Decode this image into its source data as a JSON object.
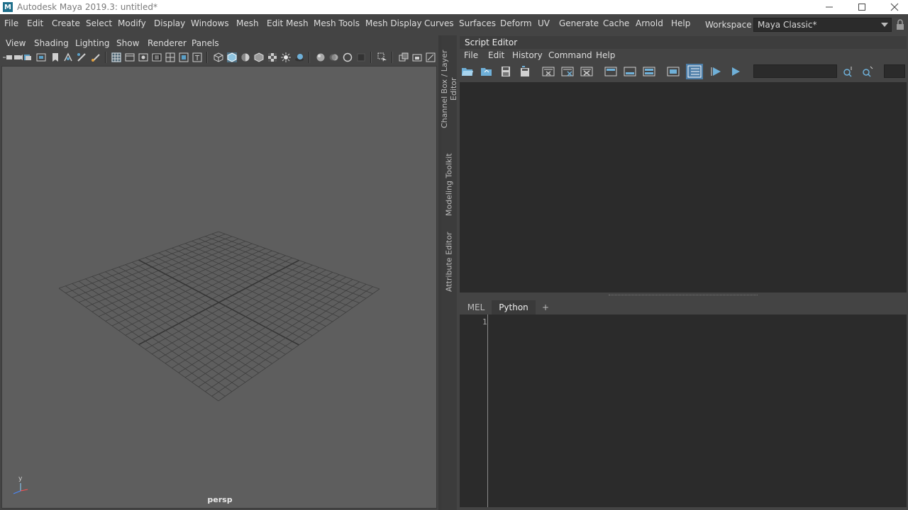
{
  "titlebar": {
    "app_icon": "maya-logo-icon",
    "title": "Autodesk Maya 2019.3: untitled*"
  },
  "menubar": {
    "items": [
      "File",
      "Edit",
      "Create",
      "Select",
      "Modify",
      "Display",
      "Windows",
      "Mesh",
      "Edit Mesh",
      "Mesh Tools",
      "Mesh Display",
      "Curves",
      "Surfaces",
      "Deform",
      "UV",
      "Generate",
      "Cache",
      "Arnold",
      "Help"
    ]
  },
  "workspace": {
    "label": "Workspace :",
    "value": "Maya Classic*"
  },
  "viewport": {
    "menu": [
      "View",
      "Shading",
      "Lighting",
      "Show",
      "Renderer",
      "Panels"
    ],
    "camera": "persp",
    "axis_label": "y",
    "grid_color": "#3f3f3f",
    "background": "#5e5e5e"
  },
  "side_tabs": [
    "Channel Box / Layer Editor",
    "Modeling Toolkit",
    "Attribute Editor"
  ],
  "script_editor": {
    "title": "Script Editor",
    "menu": [
      "File",
      "Edit",
      "History",
      "Command",
      "Help"
    ],
    "tabs": [
      {
        "label": "MEL",
        "active": false
      },
      {
        "label": "Python",
        "active": true
      },
      {
        "label": "+",
        "active": false
      }
    ],
    "line_number": "1"
  }
}
